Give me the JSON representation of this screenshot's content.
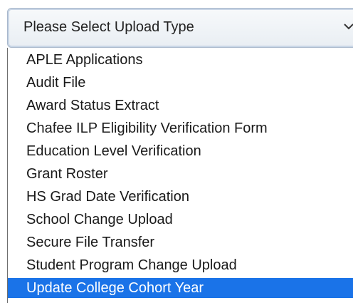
{
  "select": {
    "value": "Please Select Upload Type",
    "chevron_icon": "chevron-down-icon"
  },
  "options": [
    {
      "label": "APLE Applications"
    },
    {
      "label": "Audit File"
    },
    {
      "label": "Award Status Extract"
    },
    {
      "label": "Chafee ILP Eligibility Verification Form"
    },
    {
      "label": "Education Level Verification"
    },
    {
      "label": "Grant Roster"
    },
    {
      "label": "HS Grad Date Verification"
    },
    {
      "label": "School Change Upload"
    },
    {
      "label": "Secure File Transfer"
    },
    {
      "label": "Student Program Change Upload"
    },
    {
      "label": "Update College Cohort Year"
    }
  ],
  "highlighted_option": "Update College Cohort Year",
  "colors": {
    "highlight": "#1a73e8",
    "highlight_text": "#ffffff",
    "text": "#1a1a1a"
  }
}
